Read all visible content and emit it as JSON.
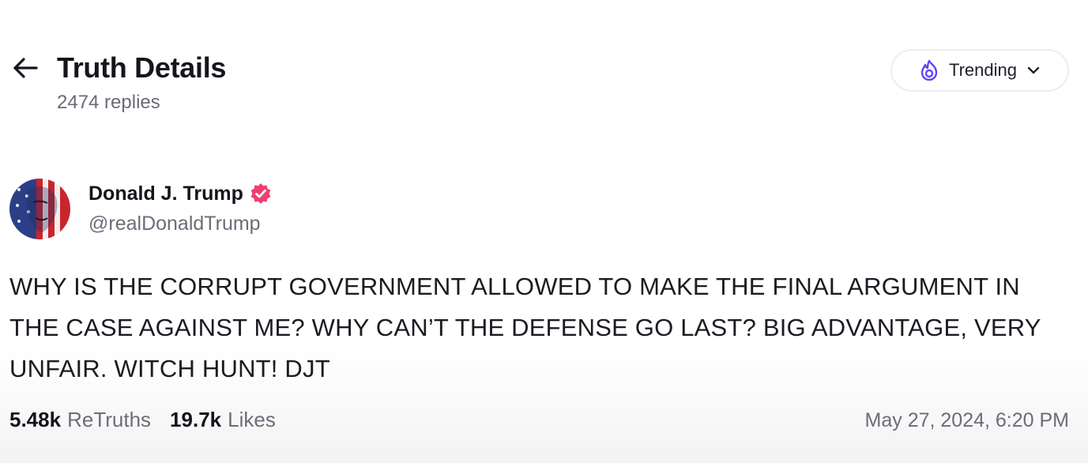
{
  "header": {
    "title": "Truth Details",
    "replies": "2474 replies",
    "back_icon": "arrow-left-icon",
    "sort": {
      "label": "Trending",
      "icon": "flame-icon",
      "dropdown_icon": "chevron-down-icon",
      "accent_color": "#6145f2"
    }
  },
  "post": {
    "author": {
      "name": "Donald J. Trump",
      "handle": "@realDonaldTrump",
      "verified_icon": "verified-badge-icon",
      "verified_color": "#ef3f6f"
    },
    "text": "WHY IS THE CORRUPT GOVERNMENT ALLOWED TO MAKE THE FINAL ARGUMENT IN THE CASE AGAINST ME? WHY CAN’T THE DEFENSE GO LAST? BIG ADVANTAGE, VERY UNFAIR. WITCH HUNT! DJT",
    "stats": {
      "retruths_count": "5.48k",
      "retruths_label": "ReTruths",
      "likes_count": "19.7k",
      "likes_label": "Likes"
    },
    "timestamp": "May 27, 2024, 6:20 PM"
  }
}
